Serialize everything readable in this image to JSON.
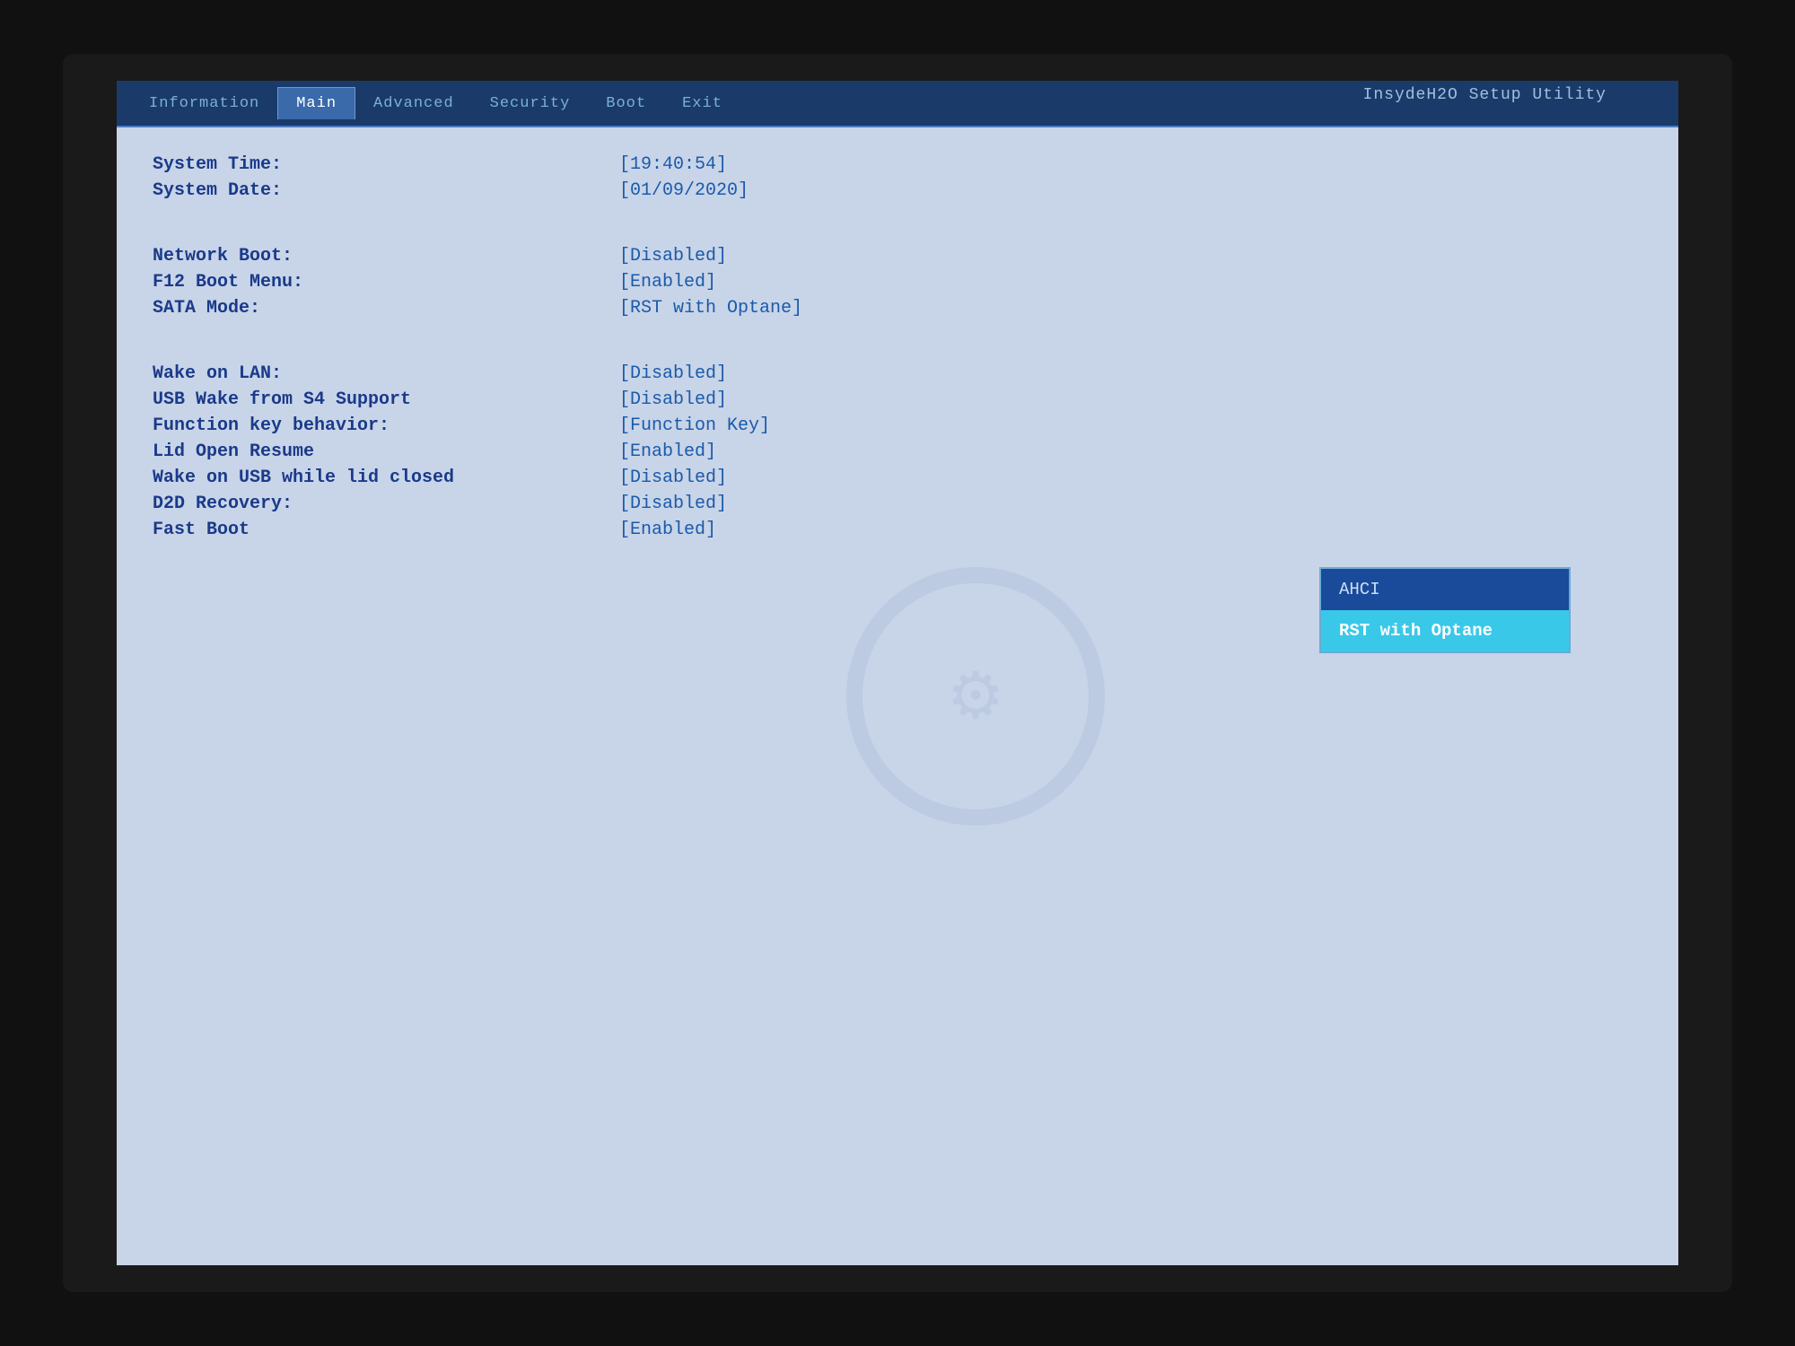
{
  "bios": {
    "title": "InsydeH2O Setup Utility",
    "tabs": [
      {
        "label": "Information",
        "active": false
      },
      {
        "label": "Main",
        "active": true
      },
      {
        "label": "Advanced",
        "active": false
      },
      {
        "label": "Security",
        "active": false
      },
      {
        "label": "Boot",
        "active": false
      },
      {
        "label": "Exit",
        "active": false
      }
    ],
    "settings": {
      "system_time_label": "System Time:",
      "system_time_value": "[19:40:54]",
      "system_date_label": "System Date:",
      "system_date_value": "[01/09/2020]",
      "network_boot_label": "Network Boot:",
      "network_boot_value": "[Disabled]",
      "f12_boot_label": "F12 Boot Menu:",
      "f12_boot_value": "[Enabled]",
      "sata_mode_label": "SATA Mode:",
      "sata_mode_value": "[RST with Optane]",
      "wake_lan_label": "Wake on LAN:",
      "wake_lan_value": "[Disabled]",
      "usb_wake_label": "USB Wake from S4 Support",
      "usb_wake_value": "[Disabled]",
      "function_key_label": "Function key behavior:",
      "function_key_value": "[Function Key]",
      "lid_open_label": "Lid Open Resume",
      "lid_open_value": "[Enabled]",
      "wake_usb_label": "Wake on USB while lid closed",
      "wake_usb_value": "[Disabled]",
      "d2d_recovery_label": "D2D Recovery:",
      "d2d_recovery_value": "[Disabled]",
      "fast_boot_label": "Fast Boot",
      "fast_boot_value": "[Enabled]"
    },
    "dropdown": {
      "option1": "AHCI",
      "option2": "RST with Optane"
    }
  }
}
